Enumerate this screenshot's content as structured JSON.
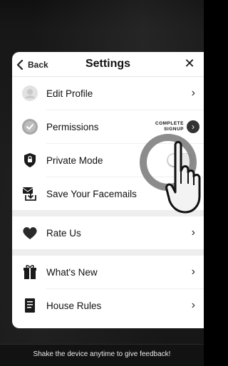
{
  "header": {
    "back_label": "Back",
    "title": "Settings",
    "close_symbol": "✕"
  },
  "rows": [
    {
      "label": "Edit Profile",
      "icon": "avatar-placeholder-icon",
      "accessory": "chevron"
    },
    {
      "label": "Permissions",
      "icon": "checkmark-badge-icon",
      "accessory": "complete-signup",
      "accessory_text_1": "COMPLETE",
      "accessory_text_2": "SIGNUP"
    },
    {
      "label": "Private Mode",
      "icon": "shield-icon",
      "accessory": "toggle",
      "toggle_on": false
    },
    {
      "label": "Save Your Facemails",
      "icon": "download-mail-icon",
      "accessory": "toggle",
      "toggle_on": false
    },
    {
      "label": "Rate Us",
      "icon": "heart-icon",
      "accessory": "chevron"
    },
    {
      "label": "What's New",
      "icon": "gift-icon",
      "accessory": "chevron"
    },
    {
      "label": "House Rules",
      "icon": "document-icon",
      "accessory": "chevron"
    }
  ],
  "chevron_symbol": "›",
  "footer": {
    "feedback_text": "Shake the device anytime to give feedback!"
  },
  "colors": {
    "background": "#171717",
    "card": "#ffffff",
    "text": "#111111",
    "divider": "#eeeeee",
    "toggle_off": "#e9e9e9"
  }
}
